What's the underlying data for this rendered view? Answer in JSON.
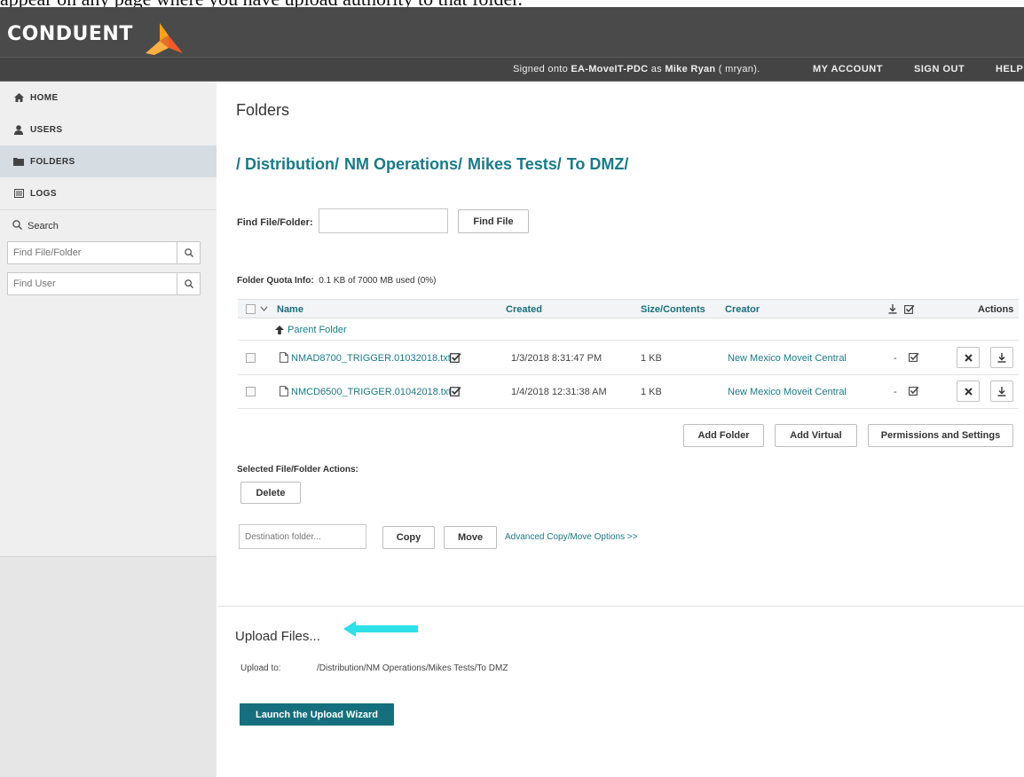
{
  "doc_caption": "appear on any page where you have upload authority to that folder.",
  "brand": {
    "logo_text": "CONDUENT"
  },
  "topnav": {
    "signed_prefix": "Signed onto ",
    "signed_host": "EA-MoveIT-PDC",
    "signed_middle": " as ",
    "signed_user": "Mike Ryan",
    "signed_suffix": " ( mryan).",
    "my_account": "MY ACCOUNT",
    "sign_out": "SIGN OUT",
    "help": "HELP"
  },
  "sidebar": {
    "items": [
      {
        "label": "HOME",
        "icon": "home-icon"
      },
      {
        "label": "USERS",
        "icon": "user-icon"
      },
      {
        "label": "FOLDERS",
        "icon": "folder-icon",
        "active": true
      },
      {
        "label": "LOGS",
        "icon": "logs-icon"
      }
    ],
    "search_heading": "Search",
    "find_file_placeholder": "Find File/Folder",
    "find_user_placeholder": "Find User"
  },
  "main": {
    "title": "Folders",
    "breadcrumb": [
      "/ Distribution/",
      "NM Operations/",
      "Mikes Tests/",
      "To DMZ/"
    ],
    "find_label": "Find File/Folder:",
    "find_input_value": "",
    "find_button": "Find File",
    "quota_label": "Folder Quota Info:",
    "quota_value": "0.1 KB of 7000 MB used (0%)",
    "table": {
      "headers": {
        "name": "Name",
        "created": "Created",
        "size": "Size/Contents",
        "creator": "Creator",
        "actions": "Actions"
      },
      "parent_folder": "Parent Folder",
      "rows": [
        {
          "name": "NMAD8700_TRIGGER.01032018.txt",
          "created": "1/3/2018 8:31:47 PM",
          "size": "1 KB",
          "creator": "New Mexico Moveit Central",
          "download_status": "-"
        },
        {
          "name": "NMCD6500_TRIGGER.01042018.txt",
          "created": "1/4/2018 12:31:38 AM",
          "size": "1 KB",
          "creator": "New Mexico Moveit Central",
          "download_status": "-"
        }
      ]
    },
    "add_folder": "Add Folder",
    "add_virtual": "Add Virtual",
    "permissions": "Permissions and Settings",
    "selected_actions_label": "Selected File/Folder Actions:",
    "delete": "Delete",
    "destination_placeholder": "Destination folder...",
    "copy": "Copy",
    "move": "Move",
    "advanced_link": "Advanced Copy/Move Options >>",
    "upload": {
      "title": "Upload Files...",
      "to_label": "Upload to:",
      "to_path": "/Distribution/NM Operations/Mikes Tests/To DMZ",
      "wizard_button": "Launch the Upload Wizard"
    }
  },
  "colors": {
    "accent": "#1a7a86",
    "topbar": "#4a4a4a",
    "arrow": "#2fe0e8",
    "wizard": "#166f7c"
  }
}
